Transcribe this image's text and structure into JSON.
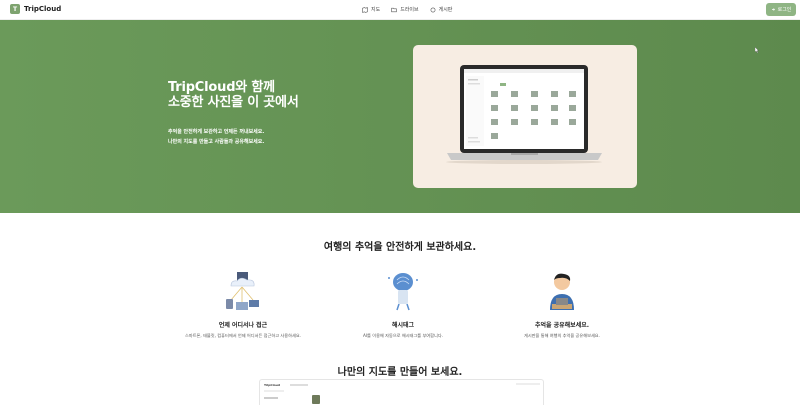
{
  "header": {
    "logo_letter": "T",
    "logo_text": "TripCloud",
    "nav": [
      {
        "label": "지도",
        "icon": "map-icon"
      },
      {
        "label": "드라이브",
        "icon": "folder-icon"
      },
      {
        "label": "게시판",
        "icon": "chat-icon"
      }
    ],
    "login_label": "로그인",
    "login_icon": "login-icon"
  },
  "hero": {
    "title_line1": "TripCloud와 함께",
    "title_line2": "소중한 사진을 이 곳에서",
    "desc_line1": "추억을 안전하게 보관하고 언제든 꺼내보세요.",
    "desc_line2": "나만의 지도를 만들고 사람들과 공유해보세요."
  },
  "section_features": {
    "title": "여행의 추억을 안전하게 보관하세요.",
    "items": [
      {
        "title": "언제 어디서나 접근",
        "desc": "스마트폰, 태블릿, 컴퓨터에서 언제 어디서든 접근하고 사용하세요."
      },
      {
        "title": "해시태그",
        "desc": "AI를 이용해 자동으로 해시태그를 부여합니다."
      },
      {
        "title": "추억을 공유해보세요.",
        "desc": "게시판을 통해 여행의 추억을 공유해보세요."
      }
    ]
  },
  "section_map": {
    "title": "나만의 지도를 만들어 보세요.",
    "preview_app": "TripCloud"
  },
  "colors": {
    "hero_bg": "#6b9a5a",
    "accent": "#8fb584",
    "card_bg": "#f7ede3"
  }
}
